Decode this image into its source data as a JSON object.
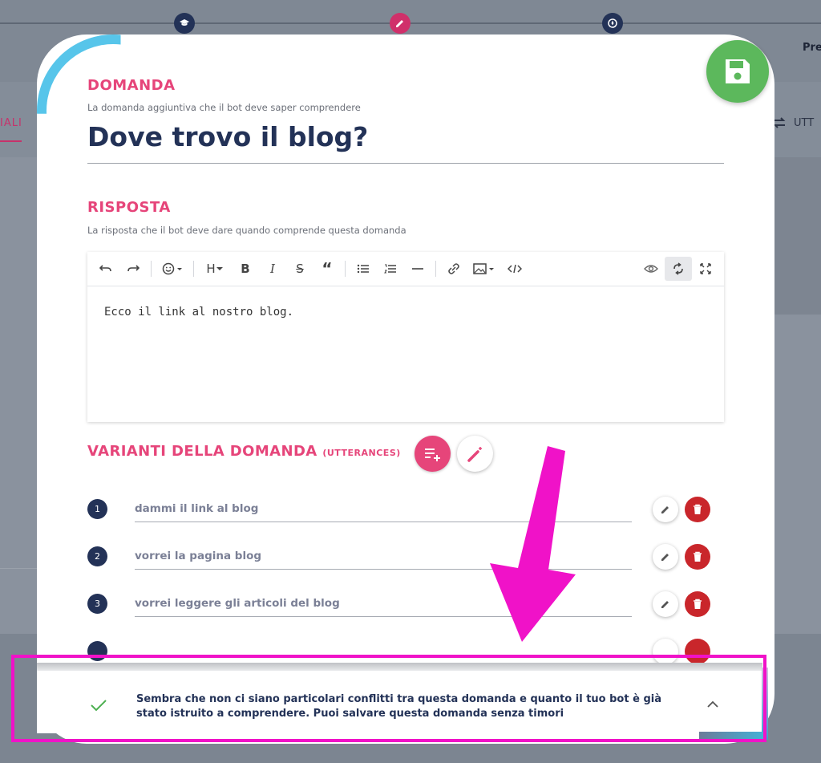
{
  "background": {
    "step_partial_label": "Pre",
    "tab_left_label": "IALI",
    "tab_right_label": "UTT"
  },
  "question_section": {
    "title": "DOMANDA",
    "subtitle": "La domanda aggiuntiva che il bot deve saper comprendere",
    "question": "Dove trovo il blog?"
  },
  "answer_section": {
    "title": "RISPOSTA",
    "subtitle": "La risposta che il bot deve dare quando comprende questa domanda",
    "editor_content": "Ecco il link al nostro blog.",
    "toolbar": {
      "heading_label": "H",
      "bold_label": "B",
      "italic_label": "I",
      "strike_label": "S",
      "quote_label": "“"
    }
  },
  "variants_section": {
    "title": "VARIANTI DELLA DOMANDA",
    "title_suffix": "(UTTERANCES)",
    "items": [
      {
        "number": "1",
        "text": "dammi il link al blog"
      },
      {
        "number": "2",
        "text": "vorrei la pagina blog"
      },
      {
        "number": "3",
        "text": "vorrei leggere gli articoli del blog"
      }
    ]
  },
  "notification": {
    "message": "Sembra che non ci siano particolari conflitti tra questa domanda e quanto il tuo bot è già stato istruito a comprendere. Puoi salvare questa domanda senza timori"
  },
  "colors": {
    "accent_pink": "#e6457a",
    "navy": "#233257",
    "save_green": "#5cb85c",
    "delete_red": "#c9262b",
    "highlight_magenta": "#f012c8"
  },
  "icons": [
    "graduation-cap-icon",
    "pencil-icon",
    "rocket-icon",
    "floppy-disk-icon",
    "repeat-icon",
    "undo-icon",
    "redo-icon",
    "emoji-icon",
    "bullet-list-icon",
    "numbered-list-icon",
    "horizontal-rule-icon",
    "link-icon",
    "image-icon",
    "code-icon",
    "eye-icon",
    "sync-icon",
    "fullscreen-icon",
    "playlist-add-icon",
    "magic-wand-icon",
    "edit-icon",
    "trash-icon",
    "check-icon",
    "chevron-up-icon",
    "arrow-down-icon"
  ]
}
